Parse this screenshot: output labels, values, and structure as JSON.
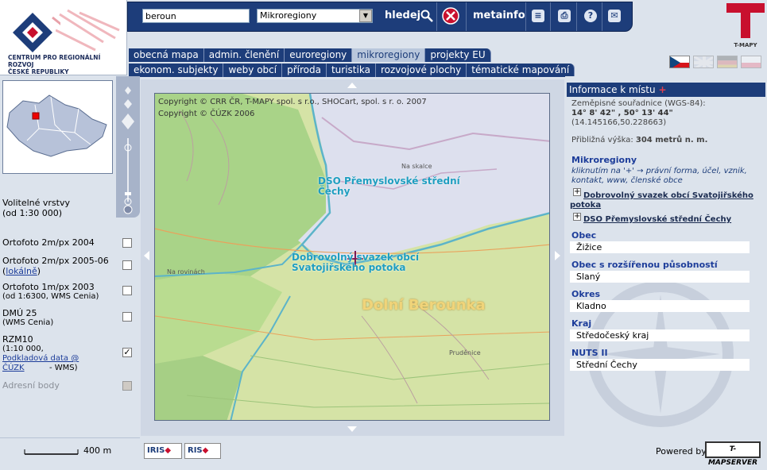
{
  "header": {
    "logo_line1": "CENTRUM PRO REGIONÁLNÍ ROZVOJ",
    "logo_line2": "ČESKÉ REPUBLIKY",
    "search_value": "beroun",
    "select_value": "Mikroregiony",
    "search_button": "hledej",
    "metainfo": "metainfo",
    "tmapy_label": "T-MAPY"
  },
  "tabs_row1": [
    "obecná mapa",
    "admin. členění",
    "euroregiony",
    "mikroregiony",
    "projekty EU"
  ],
  "tabs_row2": [
    "ekonom. subjekty",
    "weby obcí",
    "příroda",
    "turistika",
    "rozvojové plochy",
    "tématické mapování"
  ],
  "active_tab": "mikroregiony",
  "layers": {
    "title": "Volitelné vrstvy",
    "subtitle": "(od 1:30 000)",
    "items": [
      {
        "name": "Ortofoto 2m/px 2004",
        "checked": false
      },
      {
        "name": "Ortofoto 2m/px 2005-06",
        "link": "lokálně",
        "checked": false
      },
      {
        "name": "Ortofoto 1m/px 2003",
        "note": "(od 1:6300, WMS Cenia)",
        "checked": false
      },
      {
        "name": "DMÚ 25",
        "note": "(WMS Cenia)",
        "checked": false
      },
      {
        "name": "RZM10",
        "note": "(1:10 000,",
        "link": "Podkladová data @ ČÚZK",
        "note2": "- WMS)",
        "checked": true
      },
      {
        "name": "Adresní body",
        "checked": false,
        "disabled": true
      }
    ]
  },
  "map": {
    "copyright1": "Copyright © CRR ČR, T-MAPY spol. s r.o., SHOCart, spol. s r. o. 2007",
    "copyright2": "Copyright © ČÚZK 2006",
    "label_dso": "DSO Přemyslovské střední Čechy",
    "label_dso_line1": "DSO Přemyslovské střední",
    "label_dso_line2": "Čechy",
    "label_dobro_line1": "Dobrovolný svazek obcí",
    "label_dobro_line2": "Svatojiřského potoka",
    "label_region": "Dolní Berounka",
    "place1": "Na skalce",
    "place2": "Pruděnice",
    "place3": "Na rovinách"
  },
  "scale": {
    "value": "400 m"
  },
  "footer": {
    "iris": "IRIS",
    "ris": "RIS",
    "powered_by": "Powered by",
    "server": "T-MAPSERVER"
  },
  "info": {
    "header": "Informace k místu",
    "coords_label": "Zeměpisné souřadnice (WGS-84):",
    "coords_dms": "14° 8' 42\" , 50° 13' 44\"",
    "coords_dec": "(14.145166,50.228663)",
    "altitude_label": "Přibližná výška:",
    "altitude_value": "304 metrů n. m.",
    "micro_title": "Mikroregiony",
    "micro_hint": "kliknutím na '+' → právní forma, účel, vznik, kontakt, www, členské obce",
    "micro_items": [
      "Dobrovolný svazek obcí Svatojiřského potoka",
      "DSO Přemyslovské střední Čechy"
    ],
    "obec_label": "Obec",
    "obec_value": "Žižice",
    "orp_label": "Obec s rozšířenou působností",
    "orp_value": "Slaný",
    "okres_label": "Okres",
    "okres_value": "Kladno",
    "kraj_label": "Kraj",
    "kraj_value": "Středočeský kraj",
    "nuts_label": "NUTS II",
    "nuts_value": "Střední Čechy"
  },
  "colors": {
    "nav": "#1d3d7a",
    "accent": "#c8102e",
    "panel": "#dce3ec"
  }
}
